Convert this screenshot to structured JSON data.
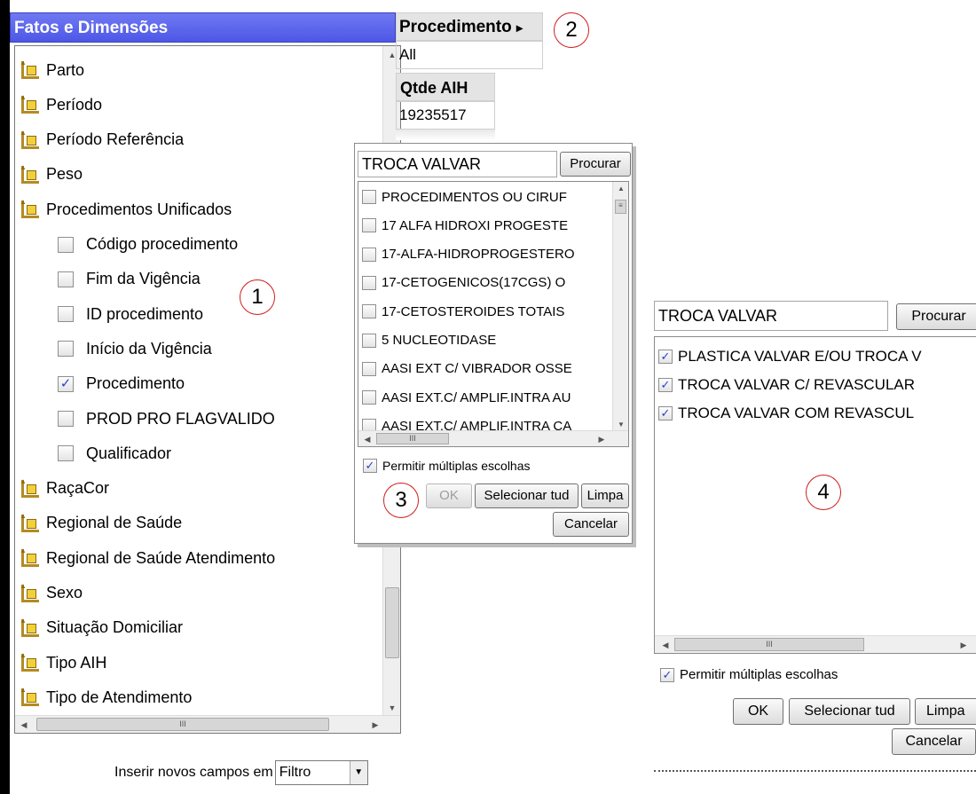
{
  "left_panel": {
    "title": "Fatos e Dimensões",
    "tree_items": [
      {
        "label": "Parto",
        "type": "dimension"
      },
      {
        "label": "Período",
        "type": "dimension"
      },
      {
        "label": "Período Referência",
        "type": "dimension"
      },
      {
        "label": "Peso",
        "type": "dimension"
      },
      {
        "label": "Procedimentos Unificados",
        "type": "dimension"
      },
      {
        "label": "Código procedimento",
        "type": "field",
        "checked": false
      },
      {
        "label": "Fim da Vigência",
        "type": "field",
        "checked": false
      },
      {
        "label": "ID procedimento",
        "type": "field",
        "checked": false
      },
      {
        "label": "Início da Vigência",
        "type": "field",
        "checked": false
      },
      {
        "label": "Procedimento",
        "type": "field",
        "checked": true
      },
      {
        "label": "PROD PRO FLAGVALIDO",
        "type": "field",
        "checked": false
      },
      {
        "label": "Qualificador",
        "type": "field",
        "checked": false
      },
      {
        "label": "RaçaCor",
        "type": "dimension"
      },
      {
        "label": "Regional de Saúde",
        "type": "dimension"
      },
      {
        "label": "Regional de Saúde Atendimento",
        "type": "dimension"
      },
      {
        "label": "Sexo",
        "type": "dimension"
      },
      {
        "label": "Situação Domiciliar",
        "type": "dimension"
      },
      {
        "label": "Tipo AIH",
        "type": "dimension"
      },
      {
        "label": "Tipo de Atendimento",
        "type": "dimension"
      }
    ],
    "insert_label": "Inserir novos campos em",
    "insert_select_value": "Filtro",
    "hscroll_grip": "III"
  },
  "pivot": {
    "dimension_header": "Procedimento",
    "dimension_arrow": "▸",
    "dimension_value": "All",
    "measure_header": "Qtde AIH",
    "measure_value": "19235517"
  },
  "annotations": [
    "1",
    "2",
    "3",
    "4"
  ],
  "popup3": {
    "search_value": "TROCA VALVAR",
    "search_button": "Procurar",
    "items": [
      {
        "label": "PROCEDIMENTOS OU CIRUF",
        "checked": false
      },
      {
        "label": "17 ALFA HIDROXI PROGESTE",
        "checked": false
      },
      {
        "label": "17-ALFA-HIDROPROGESTERO",
        "checked": false
      },
      {
        "label": "17-CETOGENICOS(17CGS) O",
        "checked": false
      },
      {
        "label": "17-CETOSTEROIDES TOTAIS",
        "checked": false
      },
      {
        "label": "5 NUCLEOTIDASE",
        "checked": false
      },
      {
        "label": "AASI EXT C/ VIBRADOR OSSE",
        "checked": false
      },
      {
        "label": "AASI EXT.C/ AMPLIF.INTRA AU",
        "checked": false
      },
      {
        "label": "AASI EXT.C/ AMPLIF.INTRA CA",
        "checked": false
      }
    ],
    "multi_label": "Permitir múltiplas escolhas",
    "multi_checked": true,
    "ok_button": "OK",
    "select_all_button": "Selecionar tud",
    "clear_button": "Limpa",
    "cancel_button": "Cancelar",
    "hscroll_grip": "III"
  },
  "popup4": {
    "search_value": "TROCA VALVAR",
    "search_button": "Procurar",
    "items": [
      {
        "label": "PLASTICA VALVAR E/OU TROCA V",
        "checked": true
      },
      {
        "label": "TROCA VALVAR C/ REVASCULAR",
        "checked": true
      },
      {
        "label": "TROCA VALVAR COM REVASCUL",
        "checked": true
      }
    ],
    "multi_label": "Permitir múltiplas escolhas",
    "multi_checked": true,
    "ok_button": "OK",
    "select_all_button": "Selecionar tud",
    "clear_button": "Limpa",
    "cancel_button": "Cancelar",
    "hscroll_grip": "III"
  },
  "colors": {
    "header_blue": "#5560ea",
    "annotation_red": "#d01c1c",
    "check_blue": "#2a43c9"
  }
}
